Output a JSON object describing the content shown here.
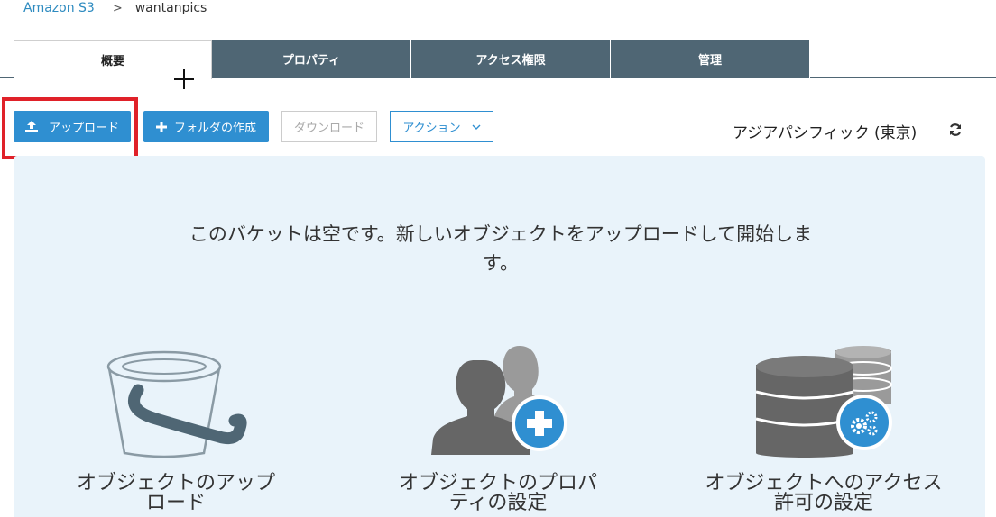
{
  "breadcrumb": {
    "root": "Amazon S3",
    "separator": ">",
    "current": "wantanpics"
  },
  "tabs": [
    {
      "label": "概要",
      "active": true
    },
    {
      "label": "プロパティ",
      "active": false
    },
    {
      "label": "アクセス権限",
      "active": false
    },
    {
      "label": "管理",
      "active": false
    }
  ],
  "toolbar": {
    "upload_label": "アップロード",
    "create_folder_label": "フォルダの作成",
    "download_label": "ダウンロード",
    "actions_label": "アクション",
    "region_label": "アジアパシフィック (東京)"
  },
  "empty_state": {
    "message": "このバケットは空です。新しいオブジェクトをアップロードして開始します。",
    "features": [
      {
        "label": "オブジェクトのアップロード",
        "icon": "bucket-icon"
      },
      {
        "label": "オブジェクトのプロパティの設定",
        "icon": "users-add-icon"
      },
      {
        "label": "オブジェクトへのアクセス許可の設定",
        "icon": "database-gear-icon"
      }
    ]
  },
  "colors": {
    "primary": "#2f8fd1",
    "tab_bg": "#4f6674",
    "panel_bg": "#e9f3fa",
    "highlight": "#e02129"
  }
}
